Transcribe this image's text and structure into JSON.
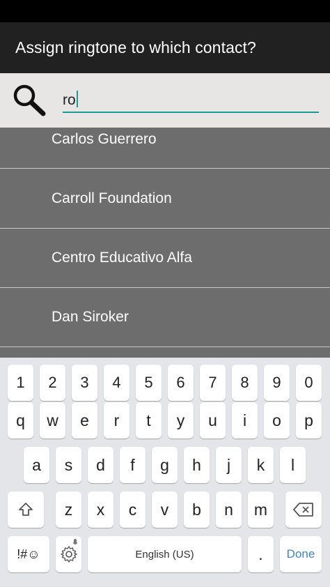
{
  "dialog": {
    "title": "Assign ringtone to which contact?"
  },
  "search": {
    "value": "ro",
    "icon": "search-icon"
  },
  "contacts": [
    {
      "name": "Carlos Guerrero"
    },
    {
      "name": "Carroll Foundation"
    },
    {
      "name": "Centro Educativo Alfa"
    },
    {
      "name": "Dan Siroker"
    }
  ],
  "keyboard": {
    "row_numbers": [
      "1",
      "2",
      "3",
      "4",
      "5",
      "6",
      "7",
      "8",
      "9",
      "0"
    ],
    "row_top": [
      "q",
      "w",
      "e",
      "r",
      "t",
      "y",
      "u",
      "i",
      "o",
      "p"
    ],
    "row_middle": [
      "a",
      "s",
      "d",
      "f",
      "g",
      "h",
      "j",
      "k",
      "l"
    ],
    "row_bottom": [
      "z",
      "x",
      "c",
      "v",
      "b",
      "n",
      "m"
    ],
    "symbols_label": "!#☺",
    "space_label": "English (US)",
    "period_label": ".",
    "done_label": "Done",
    "shift_icon": "shift-icon",
    "backspace_icon": "backspace-icon",
    "settings_icon": "gear-icon"
  },
  "colors": {
    "accent": "#199c95",
    "title_bar": "#212121",
    "list_background": "#6d6d6d",
    "done_text": "#3d86c6"
  }
}
